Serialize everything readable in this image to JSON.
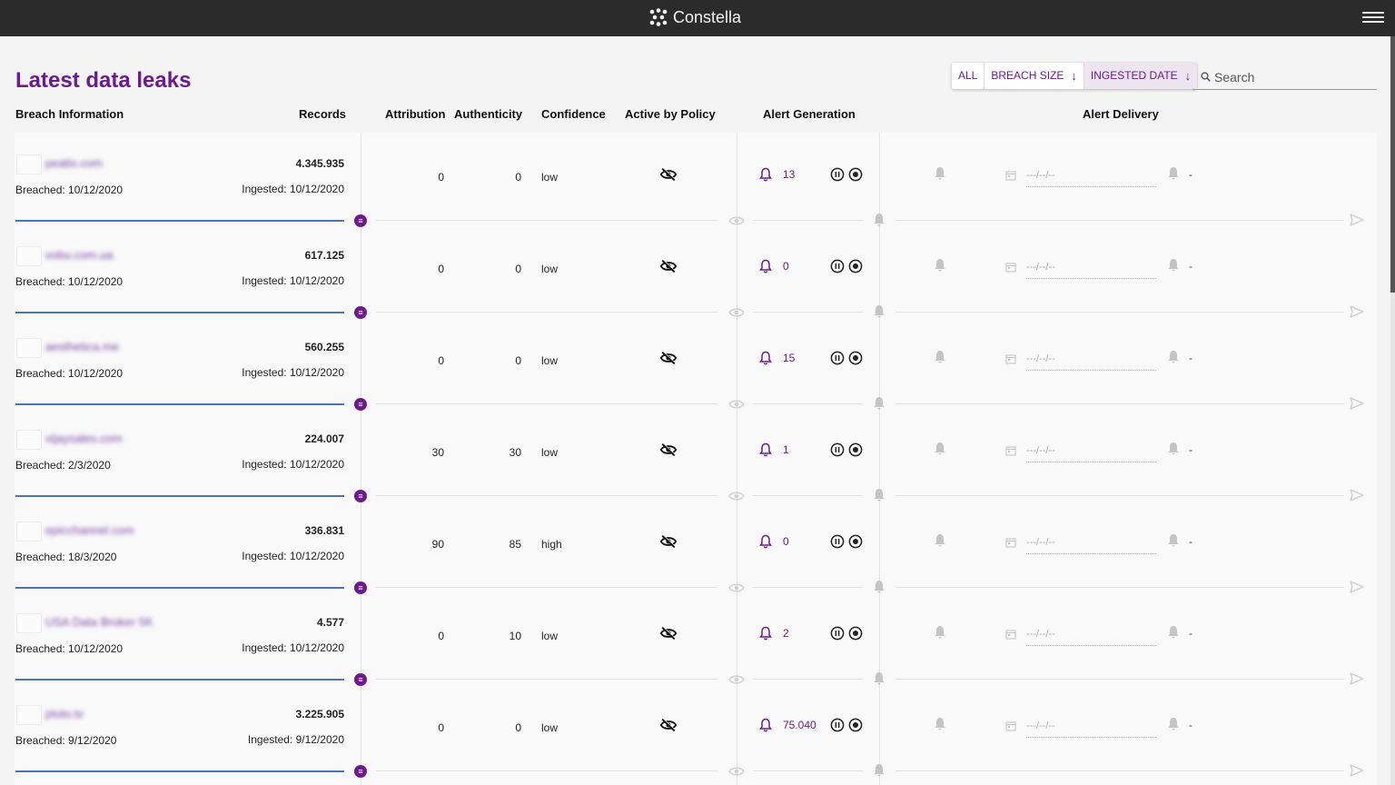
{
  "app": {
    "name": "Constella"
  },
  "page": {
    "title": "Latest data leaks"
  },
  "sort": {
    "all_label": "ALL",
    "breach_size_label": "BREACH SIZE",
    "ingested_date_label": "INGESTED DATE",
    "active": "INGESTED DATE"
  },
  "search": {
    "placeholder": "Search"
  },
  "columns": {
    "breach_information": "Breach Information",
    "records": "Records",
    "attribution": "Attribution",
    "authenticity": "Authenticity",
    "confidence": "Confidence",
    "active_by_policy": "Active by Policy",
    "alert_generation": "Alert Generation",
    "alert_delivery": "Alert Delivery"
  },
  "colors": {
    "accent": "#6d1a8c",
    "progress": "#4a74b8",
    "topbar": "#2b2b2b"
  },
  "rows": [
    {
      "name": "peatix.com",
      "records": "4.345.935",
      "breached": "Breached: 10/12/2020",
      "ingested": "Ingested: 10/12/2020",
      "attribution": "0",
      "authenticity": "0",
      "confidence": "low",
      "alerts": "13",
      "date": "---/--/--",
      "delivery": "-"
    },
    {
      "name": "vobu.com.ua",
      "records": "617.125",
      "breached": "Breached: 10/12/2020",
      "ingested": "Ingested: 10/12/2020",
      "attribution": "0",
      "authenticity": "0",
      "confidence": "low",
      "alerts": "0",
      "date": "---/--/--",
      "delivery": "-"
    },
    {
      "name": "aesthetica.me",
      "records": "560.255",
      "breached": "Breached: 10/12/2020",
      "ingested": "Ingested: 10/12/2020",
      "attribution": "0",
      "authenticity": "0",
      "confidence": "low",
      "alerts": "15",
      "date": "---/--/--",
      "delivery": "-"
    },
    {
      "name": "vijaysales.com",
      "records": "224.007",
      "breached": "Breached: 2/3/2020",
      "ingested": "Ingested: 10/12/2020",
      "attribution": "30",
      "authenticity": "30",
      "confidence": "low",
      "alerts": "1",
      "date": "---/--/--",
      "delivery": "-"
    },
    {
      "name": "epicchannel.com",
      "records": "336.831",
      "breached": "Breached: 18/3/2020",
      "ingested": "Ingested: 10/12/2020",
      "attribution": "90",
      "authenticity": "85",
      "confidence": "high",
      "alerts": "0",
      "date": "---/--/--",
      "delivery": "-"
    },
    {
      "name": "USA Data Broker 5K",
      "records": "4.577",
      "breached": "Breached: 10/12/2020",
      "ingested": "Ingested: 10/12/2020",
      "attribution": "0",
      "authenticity": "10",
      "confidence": "low",
      "alerts": "2",
      "date": "---/--/--",
      "delivery": "-"
    },
    {
      "name": "pluto.tv",
      "records": "3.225.905",
      "breached": "Breached: 9/12/2020",
      "ingested": "Ingested: 9/12/2020",
      "attribution": "0",
      "authenticity": "0",
      "confidence": "low",
      "alerts": "75.040",
      "date": "---/--/--",
      "delivery": "-"
    }
  ]
}
